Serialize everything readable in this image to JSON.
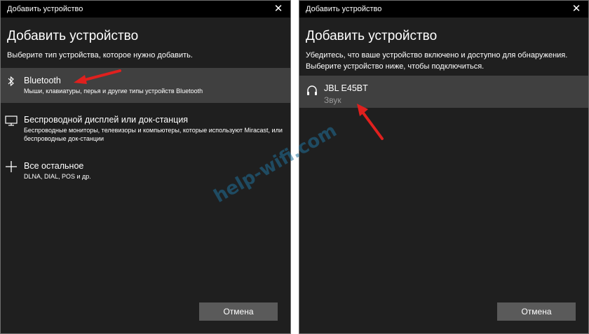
{
  "left_window": {
    "title": "Добавить устройство",
    "close_glyph": "✕",
    "heading": "Добавить устройство",
    "subtitle": "Выберите тип устройства, которое нужно добавить.",
    "items": [
      {
        "icon": "bluetooth-icon",
        "label": "Bluetooth",
        "desc": "Мыши, клавиатуры, перья и другие типы устройств Bluetooth",
        "selected": true
      },
      {
        "icon": "monitor-icon",
        "label": "Беспроводной дисплей или док-станция",
        "desc": "Беспроводные мониторы, телевизоры и компьютеры, которые используют Miracast, или беспроводные док-станции",
        "selected": false
      },
      {
        "icon": "plus-icon",
        "label": "Все остальное",
        "desc": "DLNA, DIAL, POS и др.",
        "selected": false
      }
    ],
    "cancel_label": "Отмена"
  },
  "right_window": {
    "title": "Добавить устройство",
    "close_glyph": "✕",
    "heading": "Добавить устройство",
    "subtitle": "Убедитесь, что ваше устройство включено и доступно для обнаружения. Выберите устройство ниже, чтобы подключиться.",
    "device": {
      "icon": "headphones-icon",
      "name": "JBL E45BT",
      "type": "Звук"
    },
    "cancel_label": "Отмена"
  },
  "watermark": "help-wifi.com",
  "colors": {
    "window_bg": "#1f1f1f",
    "titlebar_bg": "#000000",
    "selected_bg": "#404040",
    "button_bg": "#5a5a5a",
    "annotation_arrow": "#e0201e",
    "watermark": "#1f6f99"
  }
}
